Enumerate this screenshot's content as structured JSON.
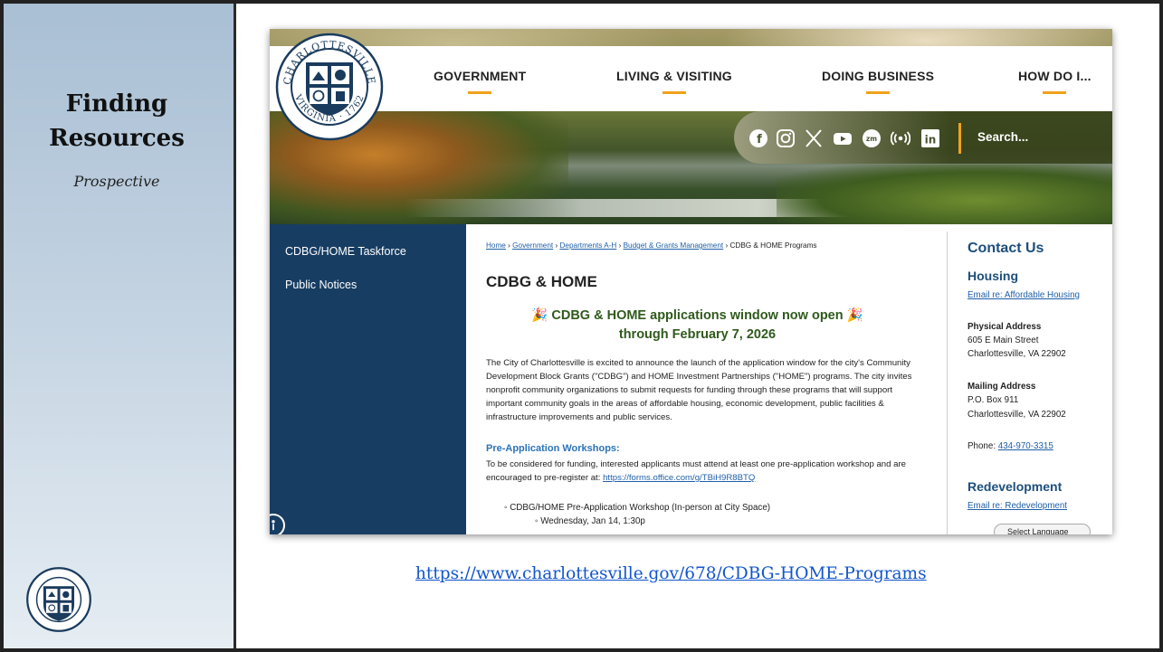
{
  "slide": {
    "title_line1": "Finding",
    "title_line2": "Resources",
    "subtitle": "Prospective",
    "url": "https://www.charlottesville.gov/678/CDBG-HOME-Programs"
  },
  "site": {
    "nav": [
      "GOVERNMENT",
      "LIVING & VISITING",
      "DOING BUSINESS",
      "HOW DO I..."
    ],
    "logo": {
      "top_text": "CHARLOTTESVILLE",
      "bottom_text": "VIRGINIA · 1762"
    },
    "social_icons": [
      "facebook-icon",
      "instagram-icon",
      "x-icon",
      "youtube-icon",
      "zoom-icon",
      "podcast-icon",
      "linkedin-icon"
    ],
    "search_placeholder": "Search...",
    "sidebar": [
      "CDBG/HOME Taskforce",
      "Public Notices"
    ],
    "breadcrumb": {
      "links": [
        "Home",
        "Government",
        "Departments A-H",
        "Budget & Grants Management"
      ],
      "current": "CDBG & HOME Programs",
      "separator": "›"
    },
    "page_title": "CDBG & HOME",
    "announcement_line1": "🎉 CDBG & HOME applications window now open 🎉",
    "announcement_line2": "through February 7, 2026",
    "intro": "The City of Charlottesville is excited to announce the launch of the application window for the city's Community Development Block Grants (\"CDBG\") and HOME Investment Partnerships (\"HOME\") programs. The city invites nonprofit community organizations to submit requests for funding through these programs that will support important community goals in the areas of affordable housing, economic development, public facilities & infrastructure improvements and public services.",
    "workshops": {
      "heading": "Pre-Application Workshops:",
      "text": "To be considered for funding, interested applicants must attend at least one pre-application workshop and are encouraged to pre-register at: ",
      "link": "https://forms.office.com/g/TBiH9R8BTQ",
      "item": "CDBG/HOME Pre-Application Workshop (In-person at City Space)",
      "sub": "Wednesday, Jan 14, 1:30p"
    },
    "contact": {
      "heading": "Contact Us",
      "housing_heading": "Housing",
      "housing_email": "Email re: Affordable Housing",
      "physical_label": "Physical Address",
      "physical_line1": "605 E Main Street",
      "physical_line2": "Charlottesville, VA 22902",
      "mailing_label": "Mailing Address",
      "mailing_line1": "P.O. Box 911",
      "mailing_line2": "Charlottesville, VA 22902",
      "phone_label": "Phone: ",
      "phone": "434-970-3315",
      "redev_heading": "Redevelopment",
      "redev_email": "Email re: Redevelopment",
      "language_select": "Select Language"
    }
  },
  "colors": {
    "sidebar": "#173d63",
    "accent": "#f0a21b",
    "heading_blue": "#1c4f7c",
    "announcement_green": "#2f5a1c",
    "link": "#1f5fa8"
  }
}
